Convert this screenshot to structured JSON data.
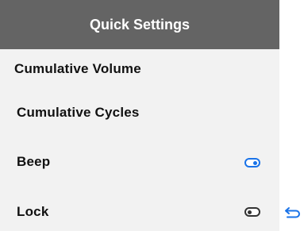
{
  "header": {
    "title": "Quick Settings"
  },
  "settings": {
    "items": [
      {
        "label": "Cumulative Volume"
      },
      {
        "label": "Cumulative Cycles"
      },
      {
        "label": "Beep",
        "control": "toggle",
        "state": "on"
      },
      {
        "label": "Lock",
        "control": "toggle",
        "state": "off"
      }
    ]
  },
  "icons": {
    "back": "back-arrow-icon"
  },
  "colors": {
    "header_bg": "#646464",
    "panel_bg": "#f2f2f2",
    "accent": "#1a73e8"
  }
}
